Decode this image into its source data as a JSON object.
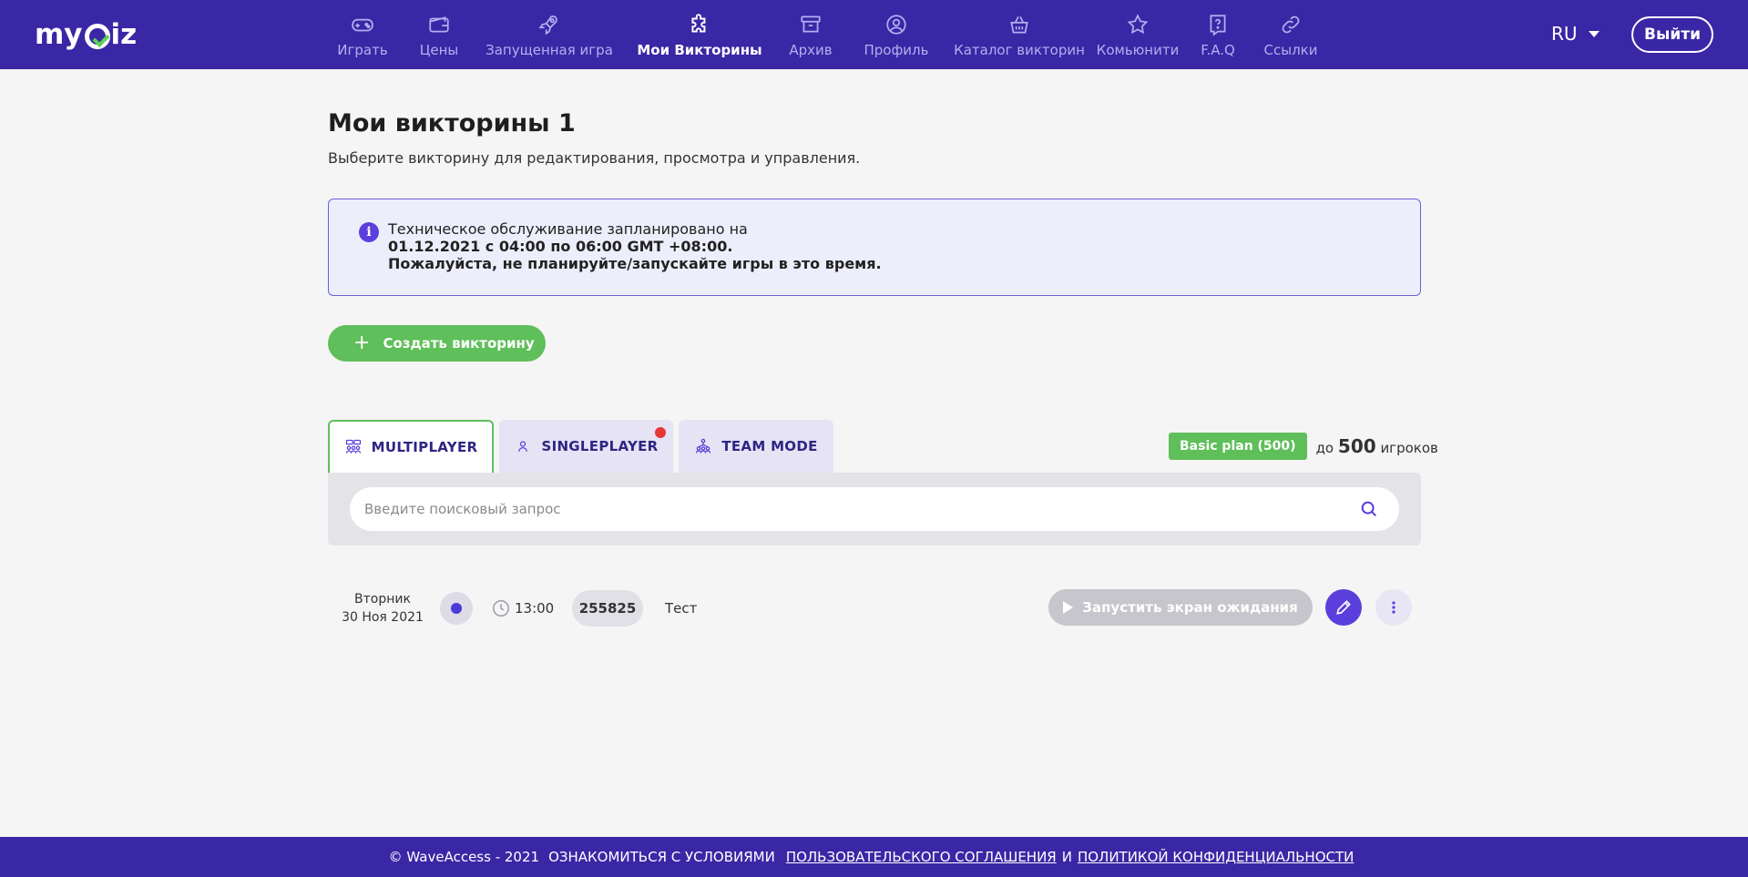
{
  "header": {
    "logo": {
      "pre": "my",
      "post": "iz"
    },
    "nav": [
      {
        "label": "Играть",
        "icon": "gamepad-icon"
      },
      {
        "label": "Цены",
        "icon": "wallet-icon"
      },
      {
        "label": "Запущенная игра",
        "icon": "rocket-icon"
      },
      {
        "label": "Мои Викторины",
        "icon": "puzzle-icon",
        "active": true
      },
      {
        "label": "Архив",
        "icon": "archive-icon"
      },
      {
        "label": "Профиль",
        "icon": "user-circle-icon"
      },
      {
        "label": "Каталог викторин",
        "icon": "basket-icon"
      },
      {
        "label": "Комьюнити",
        "icon": "star-icon"
      },
      {
        "label": "F.A.Q",
        "icon": "question-icon"
      },
      {
        "label": "Ссылки",
        "icon": "link-icon"
      }
    ],
    "lang": "RU",
    "logout": "Выйти"
  },
  "main": {
    "title": "Мои викторины 1",
    "subtitle": "Выберите викторину для редактирования, просмотра и управления.",
    "notice": {
      "line1": "Техническое обслуживание запланировано на",
      "line2": "01.12.2021 с 04:00 по 06:00 GMT +08:00.",
      "line3": "Пожалуйста, не планируйте/запускайте игры в это время."
    },
    "create_button": "Создать викторину",
    "tabs": [
      {
        "label": "MULTIPLAYER",
        "active": true
      },
      {
        "label": "SINGLEPLAYER",
        "has_notification": true
      },
      {
        "label": "TEAM MODE"
      }
    ],
    "plan": {
      "badge": "Basic plan (500)",
      "prefix": "до",
      "count": "500",
      "suffix": "игроков"
    },
    "search": {
      "placeholder": "Введите поисковый запрос",
      "value": ""
    },
    "quizzes": [
      {
        "day": "Вторник",
        "date": "30 Ноя 2021",
        "time": "13:00",
        "code": "255825",
        "name": "Тест",
        "launch_label": "Запустить экран ожидания"
      }
    ]
  },
  "footer": {
    "copyright": "© WaveAccess - 2021",
    "text": "ОЗНАКОМИТЬСЯ С УСЛОВИЯМИ",
    "link1": "ПОЛЬЗОВАТЕЛЬСКОГО СОГЛАШЕНИЯ",
    "and": "И",
    "link2": "ПОЛИТИКОЙ КОНФИДЕНЦИАЛЬНОСТИ"
  },
  "colors": {
    "brand": "#3a27a5",
    "accent_green": "#5fbf5a",
    "accent_purple": "#5b3fdc",
    "notification": "#e53935"
  }
}
